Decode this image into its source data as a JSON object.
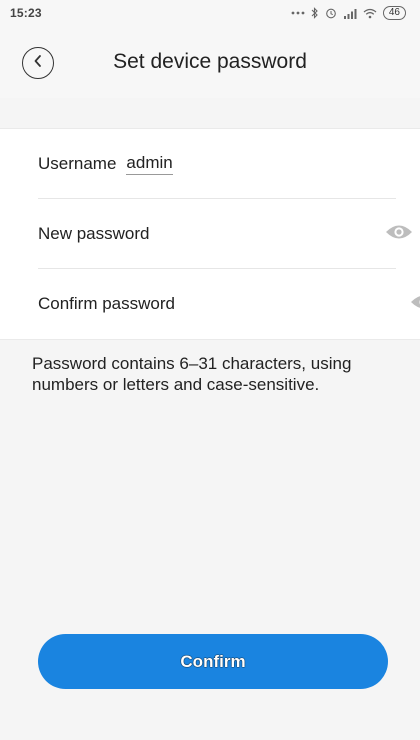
{
  "status_bar": {
    "time": "15:23",
    "battery": "46"
  },
  "header": {
    "title": "Set device password",
    "back_icon": "chevron-left-icon"
  },
  "form": {
    "username_label": "Username",
    "username_value": "admin",
    "new_password_label": "New password",
    "new_password_value": "",
    "confirm_password_label": "Confirm password",
    "confirm_password_value": "",
    "visibility_icon": "eye-icon"
  },
  "hint": "Password contains 6–31 characters, using numbers or letters and case-sensitive.",
  "confirm_label": "Confirm",
  "colors": {
    "accent": "#1a84e0",
    "background": "#f5f5f5",
    "card": "#ffffff"
  }
}
